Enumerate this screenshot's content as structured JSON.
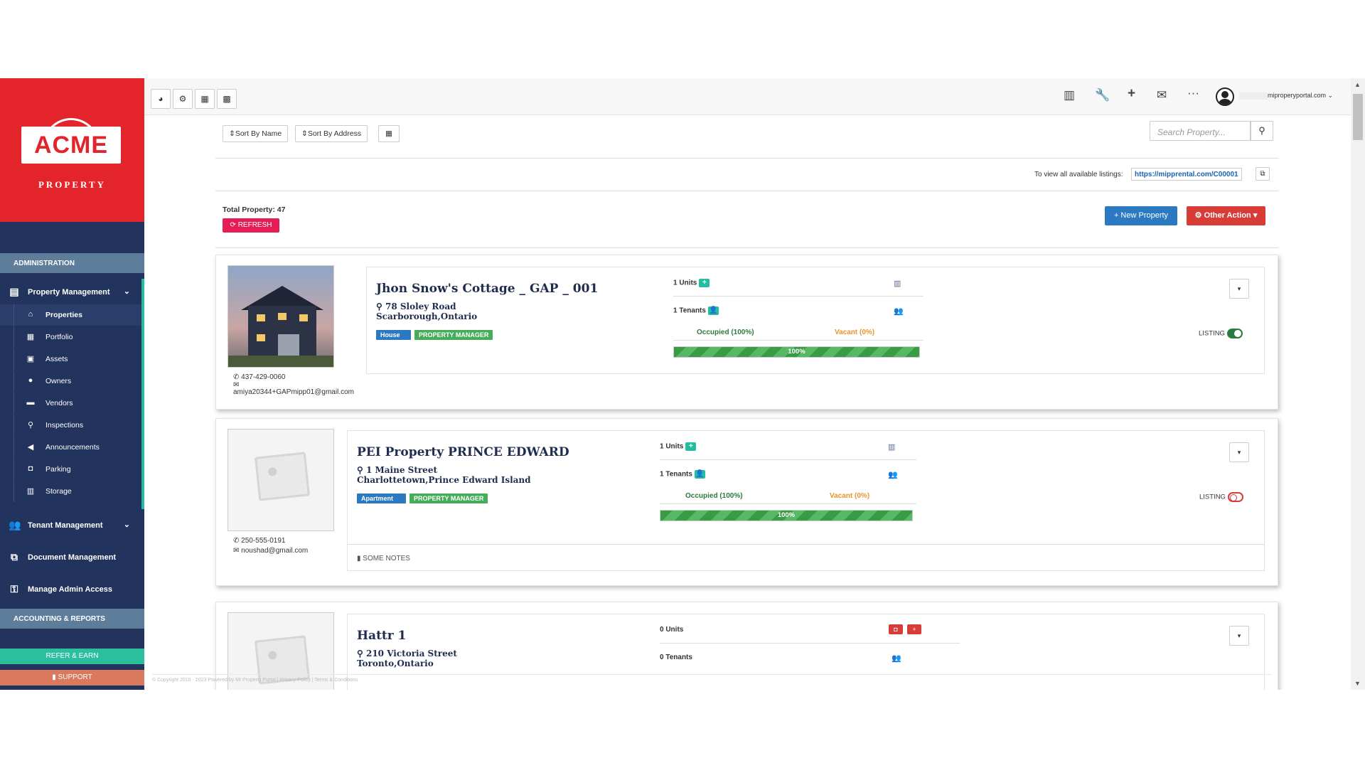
{
  "brand": {
    "logo_text": "ACME",
    "logo_sub": "PROPERTY"
  },
  "sidebar": {
    "section_admin": "ADMINISTRATION",
    "property_management": "Property Management",
    "sub_items": [
      {
        "label": "Properties",
        "icon": "home-icon"
      },
      {
        "label": "Portfolio",
        "icon": "building-icon"
      },
      {
        "label": "Assets",
        "icon": "list-icon"
      },
      {
        "label": "Owners",
        "icon": "user-icon"
      },
      {
        "label": "Vendors",
        "icon": "truck-icon"
      },
      {
        "label": "Inspections",
        "icon": "magnify-icon"
      },
      {
        "label": "Announcements",
        "icon": "bullhorn-icon"
      },
      {
        "label": "Parking",
        "icon": "car-icon"
      },
      {
        "label": "Storage",
        "icon": "box-icon"
      }
    ],
    "tenant_management": "Tenant Management",
    "document_management": "Document Management",
    "manage_admin_access": "Manage Admin Access",
    "section_accounting": "ACCOUNTING & REPORTS",
    "refer_earn": "REFER & EARN",
    "support": "SUPPORT"
  },
  "topbar": {
    "user_email": "miproperyportal.com"
  },
  "toolbar": {
    "sort_name": "Sort By Name",
    "sort_address": "Sort By Address",
    "search_placeholder": "Search Property...",
    "listing_label": "To view all available listings:",
    "listing_url": "https://mipprental.com/C00001",
    "total_property": "Total Property: 47",
    "refresh": "REFRESH",
    "new_property": "New Property",
    "other_action": "Other Action"
  },
  "properties": [
    {
      "name": "Jhon Snow's Cottage _ GAP _ 001",
      "street": "78 Sloley Road",
      "city": "Scarborough,Ontario",
      "tag_type": "House",
      "tag_role": "PROPERTY MANAGER",
      "units": "1 Units",
      "tenants": "1 Tenants",
      "occupied": "Occupied (100%)",
      "vacant": "Vacant (0%)",
      "progress_label": "100%",
      "progress": 100,
      "phone": "437-429-0060",
      "email": "amiya20344+GAPmipp01@gmail.com",
      "listing": "LISTING",
      "listing_on": true
    },
    {
      "name": "PEI Property PRINCE EDWARD",
      "street": "1 Maine Street",
      "city": "Charlottetown,Prince Edward Island",
      "tag_type": "Apartment",
      "tag_role": "PROPERTY MANAGER",
      "units": "1 Units",
      "tenants": "1 Tenants",
      "occupied": "Occupied (100%)",
      "vacant": "Vacant (0%)",
      "progress_label": "100%",
      "progress": 100,
      "phone": "250-555-0191",
      "email": "noushad@gmail.com",
      "notes": "SOME NOTES",
      "listing": "LISTING",
      "listing_on": false
    },
    {
      "name": "Hattr 1",
      "street": "210 Victoria Street",
      "city": "Toronto,Ontario",
      "units": "0 Units",
      "tenants": "0 Tenants"
    }
  ],
  "footer": "© Copyright 2016 - 2023 Powered by MI Property Portal | Privacy Policy | Terms & Conditions"
}
